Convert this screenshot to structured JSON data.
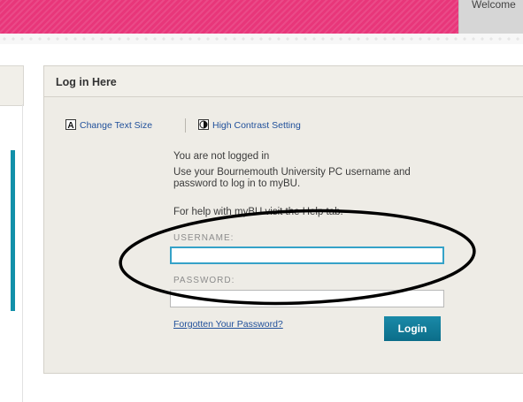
{
  "header": {
    "welcome_tab": "Welcome"
  },
  "login_panel": {
    "title": "Log in Here",
    "toolbar": {
      "text_size_label": "Change Text Size",
      "contrast_label": "High Contrast Setting"
    },
    "status_line": "You are not logged in",
    "instructions_line1": "Use your Bournemouth University PC username and",
    "instructions_line2": "password to log in to myBU.",
    "help_text": "For help with myBU visit the Help tab.",
    "username": {
      "label": "USERNAME:",
      "value": ""
    },
    "password": {
      "label": "PASSWORD:",
      "value": ""
    },
    "forgot_link": "Forgotten Your Password?",
    "login_button": "Login"
  },
  "colors": {
    "banner_pink": "#e8367a",
    "accent_teal": "#1290a9",
    "link_blue": "#1f4f9a",
    "focus_blue": "#35a2c8"
  },
  "icons": [
    "text-size-icon",
    "contrast-icon"
  ]
}
